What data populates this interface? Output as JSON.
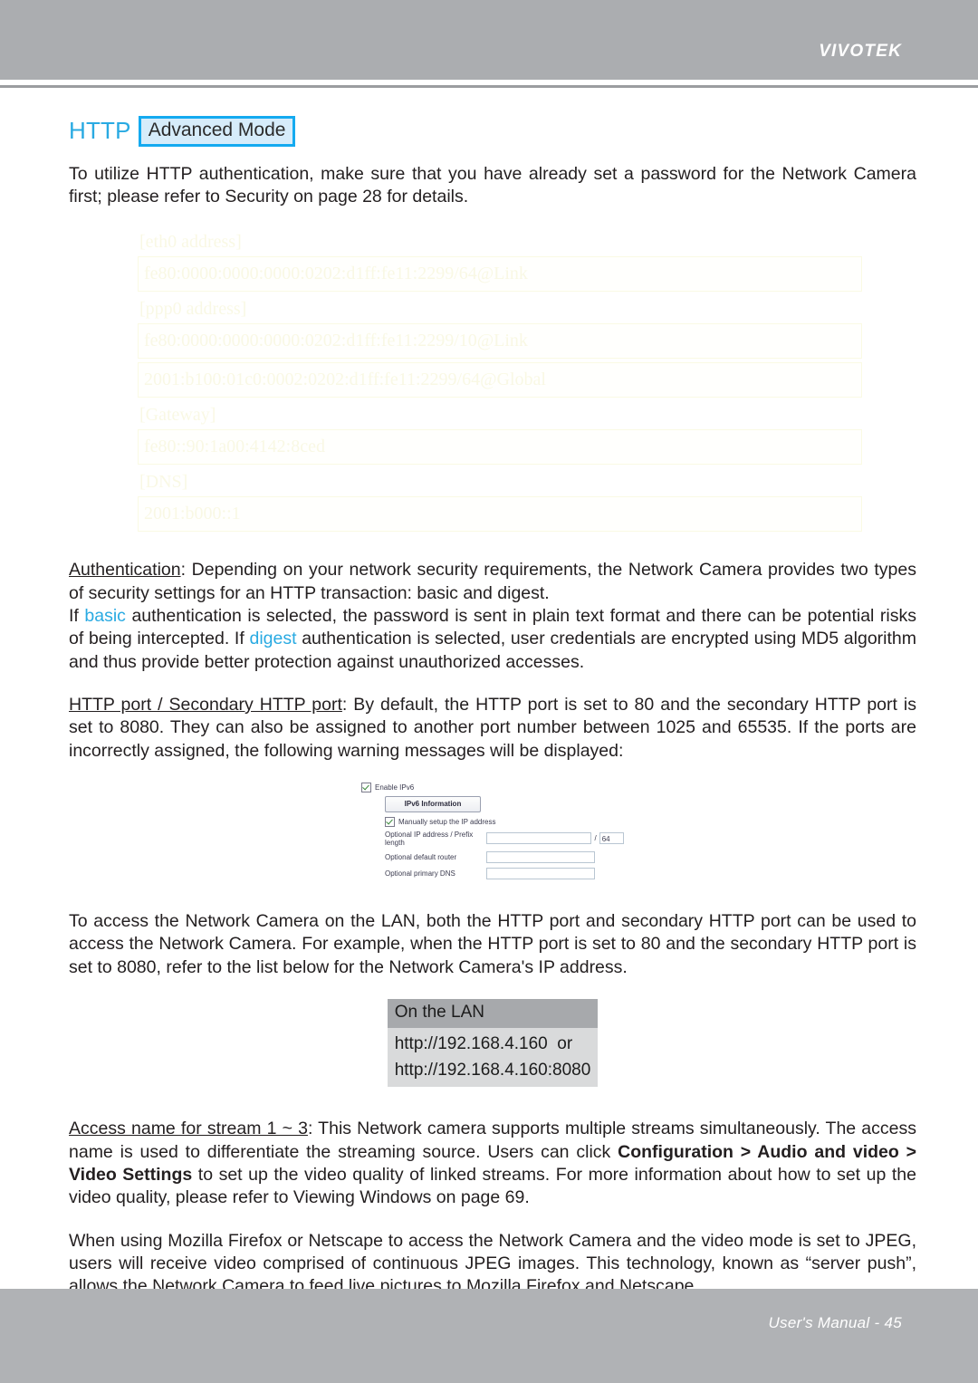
{
  "header": {
    "brand": "VIVOTEK"
  },
  "footer": {
    "text": "User's Manual - 45"
  },
  "section": {
    "title": "HTTP",
    "mode_badge": "Advanced Mode"
  },
  "paragraphs": {
    "intro": "To utilize HTTP authentication, make sure that you have already set a password for the Network Camera first; please refer to Security on page 28 for details.",
    "auth_label": "Authentication",
    "auth_line1": ": Depending on your network security requirements, the Network Camera provides two types of security settings for an HTTP transaction: basic and digest.",
    "auth_line2_a": "If ",
    "auth_basic": "basic",
    "auth_line2_b": " authentication is selected, the password is sent in plain text format and there can be potential risks of being intercepted. If ",
    "auth_digest": "digest",
    "auth_line2_c": " authentication is selected, user credentials are encrypted using MD5 algorithm and thus provide better protection against unauthorized accesses.",
    "port_label": "HTTP port / Secondary HTTP port",
    "port_body": ": By default, the HTTP port is set to 80 and the secondary HTTP port is set to 8080. They can also be assigned to another port number between 1025 and 65535. If the ports are incorrectly assigned, the following warning messages will be displayed:",
    "lan_access": "To access the Network Camera on the LAN, both the HTTP port and secondary HTTP port can be used to access the Network Camera. For example, when the HTTP port is set to 80 and the secondary HTTP port is set to 8080, refer to the list below for the Network Camera's IP address.",
    "stream_label": "Access name for stream 1 ~ 3",
    "stream_body_a": ": This Network camera supports multiple streams simultaneously. The access name is used to differentiate the streaming source. Users can click ",
    "stream_bold": "Configuration > Audio and video > Video Settings",
    "stream_body_b": " to set up the video quality of linked streams. For more information about how to set up the video quality, please refer to Viewing Windows on page 69.",
    "mozilla": "When using Mozilla Firefox or Netscape to access the Network Camera and the video mode is set to JPEG, users will receive video comprised of continuous JPEG images. This technology, known as “server push”, allows the Network Camera to feed live pictures to Mozilla Firefox and Netscape."
  },
  "ipv6_information": {
    "eth0_label": "[eth0 address]",
    "eth0_value": "fe80:0000:0000:0000:0202:d1ff:fe11:2299/64@Link",
    "ppp0_label": "[ppp0 address]",
    "ppp0_value1": "fe80:0000:0000:0000:0202:d1ff:fe11:2299/10@Link",
    "ppp0_value2": "2001:b100:01c0:0002:0202:d1ff:fe11:2299/64@Global",
    "gateway_label": "[Gateway]",
    "gateway_value": "fe80::90:1a00:4142:8ced",
    "dns_label": "[DNS]",
    "dns_value": "2001:b000::1"
  },
  "ipv6_settings": {
    "enable_label": "Enable IPv6",
    "info_button": "IPv6 Information",
    "manual_label": "Manually setup the IP address",
    "ip_prefix_label": "Optional IP address / Prefix length",
    "ip_prefix_value": "",
    "prefix_length_value": "64",
    "slash": "/",
    "router_label": "Optional default router",
    "router_value": "",
    "dns_label": "Optional primary DNS",
    "dns_value": ""
  },
  "lan_table": {
    "header": "On the LAN",
    "rows": [
      "http://192.168.4.160  or",
      "http://192.168.4.160:8080"
    ]
  }
}
